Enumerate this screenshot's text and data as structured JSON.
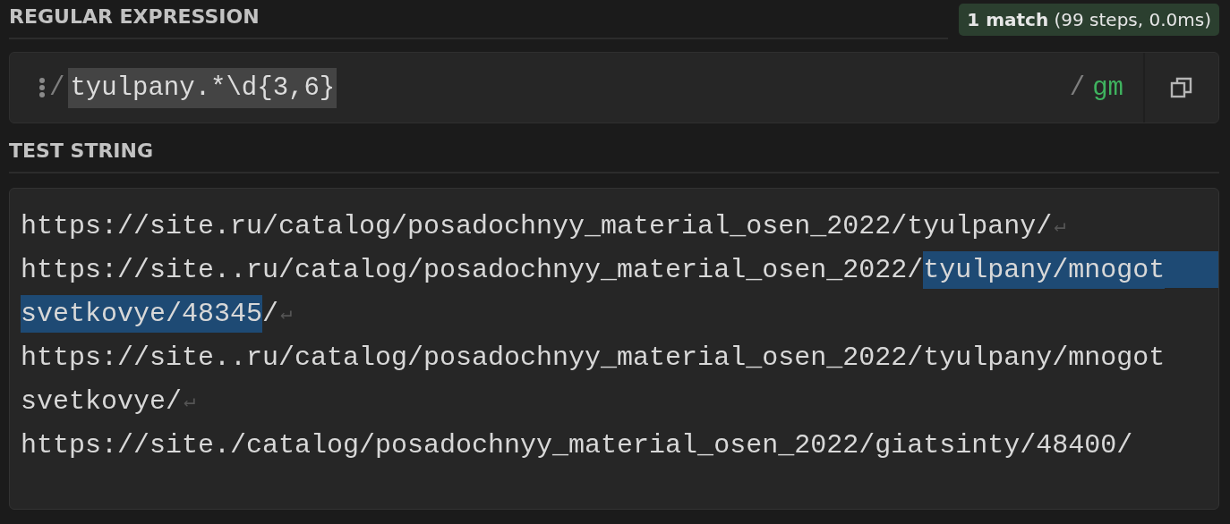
{
  "regex_section": {
    "label": "REGULAR EXPRESSION",
    "match_info": "**1 match** (99 steps, 0.0ms)",
    "delimiter_open": "/",
    "pattern": "tyulpany.*\\d{3,6}",
    "pattern_selected": true,
    "delimiter_close": "/",
    "flags": "gm"
  },
  "test_section": {
    "label": "TEST STRING",
    "lines": [
      {
        "segments": [
          {
            "text": "https://site.ru/catalog/posadochnyy_material_osen_2022/tyulpany/",
            "highlighted": false
          }
        ],
        "end_mark": "↵"
      },
      {
        "segments": [
          {
            "text": "https://site..ru/catalog/posadochnyy_material_osen_2022/",
            "highlighted": false
          },
          {
            "text": "tyulpany/mnogot",
            "highlighted": true
          }
        ]
      },
      {
        "segments": [
          {
            "text": "svetkovye/48345",
            "highlighted": true
          },
          {
            "text": "/",
            "highlighted": false
          }
        ],
        "end_mark": "↵"
      },
      {
        "segments": [
          {
            "text": "https://site..ru/catalog/posadochnyy_material_osen_2022/tyulpany/mnogot",
            "highlighted": false
          }
        ]
      },
      {
        "segments": [
          {
            "text": "svetkovye/",
            "highlighted": false
          }
        ],
        "end_mark": "↵"
      },
      {
        "segments": [
          {
            "text": "https://site./catalog/posadochnyy_material_osen_2022/giatsinty/48400/",
            "highlighted": false
          }
        ]
      }
    ]
  }
}
